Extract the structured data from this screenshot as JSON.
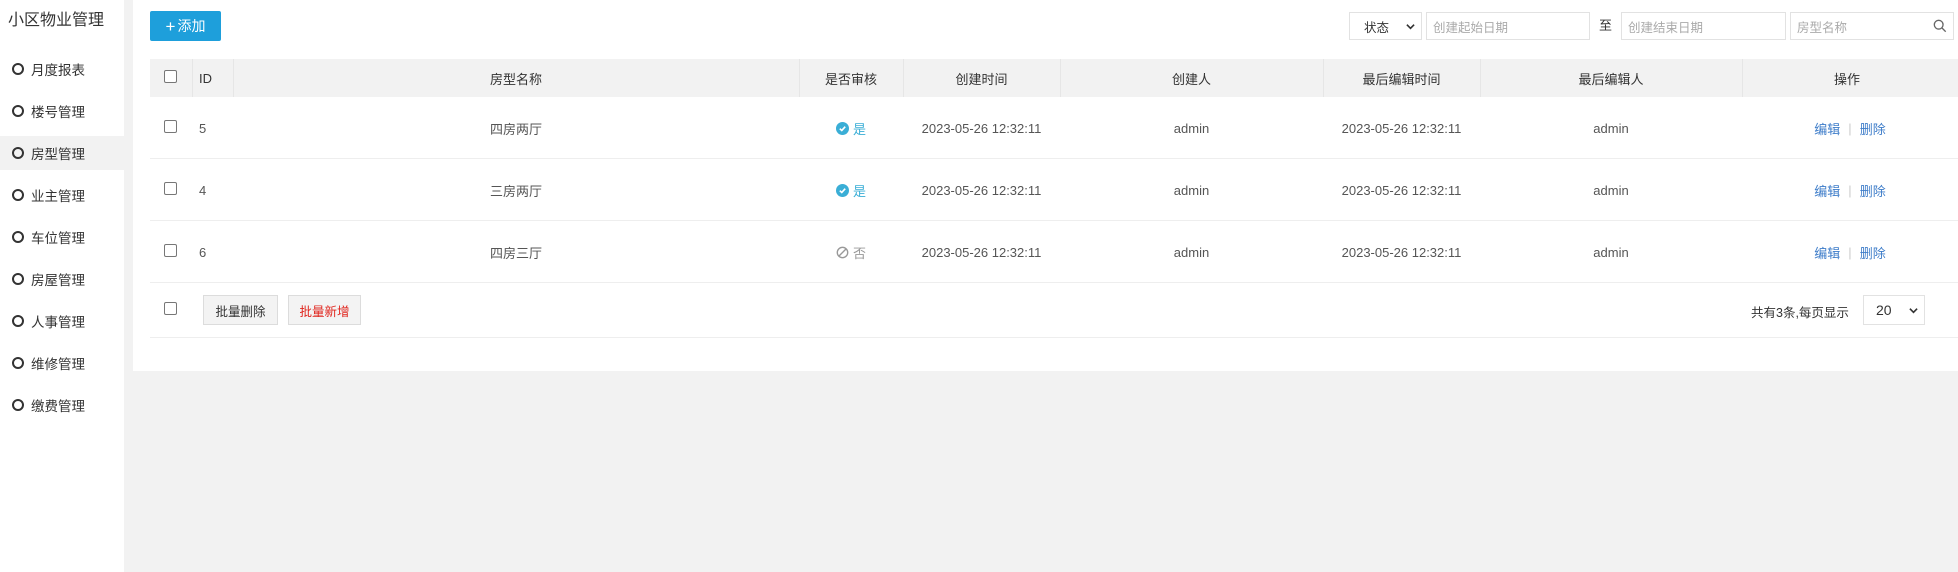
{
  "sidebar": {
    "title": "小区物业管理",
    "items": [
      {
        "label": "月度报表",
        "active": false
      },
      {
        "label": "楼号管理",
        "active": false
      },
      {
        "label": "房型管理",
        "active": true
      },
      {
        "label": "业主管理",
        "active": false
      },
      {
        "label": "车位管理",
        "active": false
      },
      {
        "label": "房屋管理",
        "active": false
      },
      {
        "label": "人事管理",
        "active": false
      },
      {
        "label": "维修管理",
        "active": false
      },
      {
        "label": "缴费管理",
        "active": false
      }
    ]
  },
  "toolbar": {
    "add_icon": "+",
    "add_label": "添加",
    "status_select": "状态",
    "start_date_placeholder": "创建起始日期",
    "to_label": "至",
    "end_date_placeholder": "创建结束日期",
    "room_type_placeholder": "房型名称"
  },
  "table": {
    "headers": {
      "id": "ID",
      "name": "房型名称",
      "audited": "是否审核",
      "created_time": "创建时间",
      "creator": "创建人",
      "last_edit_time": "最后编辑时间",
      "last_editor": "最后编辑人",
      "actions": "操作"
    },
    "rows": [
      {
        "id": "5",
        "name": "四房两厅",
        "audited": "是",
        "audited_flag": true,
        "created_time": "2023-05-26 12:32:11",
        "creator": "admin",
        "last_edit_time": "2023-05-26 12:32:11",
        "last_editor": "admin",
        "edit": "编辑",
        "sep": "|",
        "delete": "删除"
      },
      {
        "id": "4",
        "name": "三房两厅",
        "audited": "是",
        "audited_flag": true,
        "created_time": "2023-05-26 12:32:11",
        "creator": "admin",
        "last_edit_time": "2023-05-26 12:32:11",
        "last_editor": "admin",
        "edit": "编辑",
        "sep": "|",
        "delete": "删除"
      },
      {
        "id": "6",
        "name": "四房三厅",
        "audited": "否",
        "audited_flag": false,
        "created_time": "2023-05-26 12:32:11",
        "creator": "admin",
        "last_edit_time": "2023-05-26 12:32:11",
        "last_editor": "admin",
        "edit": "编辑",
        "sep": "|",
        "delete": "删除"
      }
    ]
  },
  "footer": {
    "batch_delete": "批量删除",
    "batch_add": "批量新增",
    "summary": "共有3条,每页显示",
    "page_size": "20"
  },
  "colors": {
    "primary": "#1e9fdb",
    "audited_yes": "#3aaed6",
    "link": "#3d7cc9",
    "batch_add_text": "#e0241c"
  }
}
